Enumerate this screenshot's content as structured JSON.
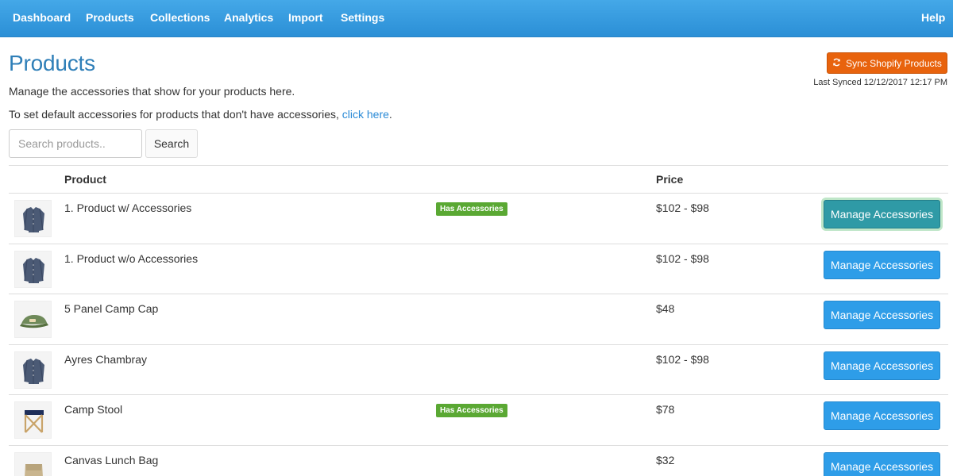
{
  "nav": {
    "items": [
      "Dashboard",
      "Products",
      "Collections",
      "Analytics",
      "Import",
      "Settings"
    ],
    "help": "Help"
  },
  "page": {
    "title": "Products",
    "description": "Manage the accessories that show for your products here.",
    "default_text": "To set default accessories for products that don't have accessories, ",
    "default_link": "click here",
    "default_suffix": "."
  },
  "sync": {
    "button_label": "Sync Shopify Products",
    "last_synced": "Last Synced 12/12/2017 12:17 PM",
    "icon": "refresh-icon",
    "color": "#e8630d"
  },
  "search": {
    "placeholder": "Search products..",
    "value": "",
    "button_label": "Search"
  },
  "table": {
    "headers": {
      "product": "Product",
      "price": "Price"
    },
    "rows": [
      {
        "name": "1. Product w/ Accessories",
        "badge": "Has Accessories",
        "price": "$102 - $98",
        "button": "Manage Accessories",
        "thumb": "shirt"
      },
      {
        "name": "1. Product w/o Accessories",
        "badge": "",
        "price": "$102 - $98",
        "button": "Manage Accessories",
        "thumb": "shirt"
      },
      {
        "name": "5 Panel Camp Cap",
        "badge": "",
        "price": "$48",
        "button": "Manage Accessories",
        "thumb": "cap"
      },
      {
        "name": "Ayres Chambray",
        "badge": "",
        "price": "$102 - $98",
        "button": "Manage Accessories",
        "thumb": "shirt"
      },
      {
        "name": "Camp Stool",
        "badge": "Has Accessories",
        "price": "$78",
        "button": "Manage Accessories",
        "thumb": "stool"
      },
      {
        "name": "Canvas Lunch Bag",
        "badge": "",
        "price": "$32",
        "button": "Manage Accessories",
        "thumb": "bag"
      }
    ]
  },
  "colors": {
    "navbar": "#2b8fd6",
    "primary_button": "#2e9de8",
    "badge": "#5aa833",
    "link": "#2a8ad6"
  }
}
